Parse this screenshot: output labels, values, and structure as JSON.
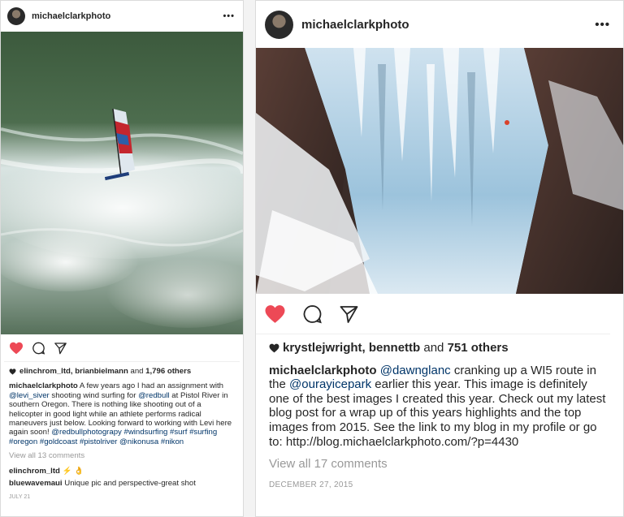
{
  "left_post": {
    "username": "michaelclarkphoto",
    "more_label": "•••",
    "likes": {
      "names": "elinchrom_ltd, brianbielmann",
      "and_text": "and",
      "count": "1,796 others"
    },
    "caption": {
      "user": "michaelclarkphoto",
      "t1": "A few years ago I had an assignment with ",
      "m1": "@levi_siver",
      "t2": " shooting wind surfing for ",
      "m2": "@redbull",
      "t3": " at Pistol River in southern Oregon. There is nothing like shooting out of a helicopter in good light while an athlete performs radical maneuvers just below. Looking forward to working with Levi here again soon! ",
      "m3": "@redbullphotograpy",
      "h1": "#windsurfing",
      "h2": "#surf",
      "h3": "#surfing",
      "h4": "#oregon",
      "h5": "#goldcoast",
      "h6": "#pistolriver",
      "m4": "@nikonusa",
      "h7": "#nikon"
    },
    "view_all": "View all 13 comments",
    "comments": [
      {
        "user": "elinchrom_ltd",
        "text": "⚡ 👌"
      },
      {
        "user": "bluewavemaui",
        "text": "Unique pic and perspective-great shot"
      }
    ],
    "date": "JULY 21"
  },
  "right_post": {
    "username": "michaelclarkphoto",
    "more_label": "•••",
    "likes": {
      "names": "krystlejwright, bennettb",
      "and_text": "and",
      "count": "751 others"
    },
    "caption": {
      "user": "michaelclarkphoto",
      "m1": "@dawnglanc",
      "t1": " cranking up a WI5 route in the ",
      "m2": "@ourayicepark",
      "t2": " earlier this year. This image is definitely one of the best images I created this year. Check out my latest blog post for a wrap up of this years highlights and the top images from 2015. See the link to my blog in my profile or go to: http://blog.michaelclarkphoto.com/?p=4430"
    },
    "view_all": "View all 17 comments",
    "date": "DECEMBER 27, 2015"
  },
  "colors": {
    "like_red": "#ed4956",
    "link_blue": "#003569",
    "muted_gray": "#999999"
  },
  "icons": [
    "heart-filled-icon",
    "comment-bubble-icon",
    "send-paper-plane-icon",
    "more-options-icon",
    "small-heart-icon"
  ]
}
